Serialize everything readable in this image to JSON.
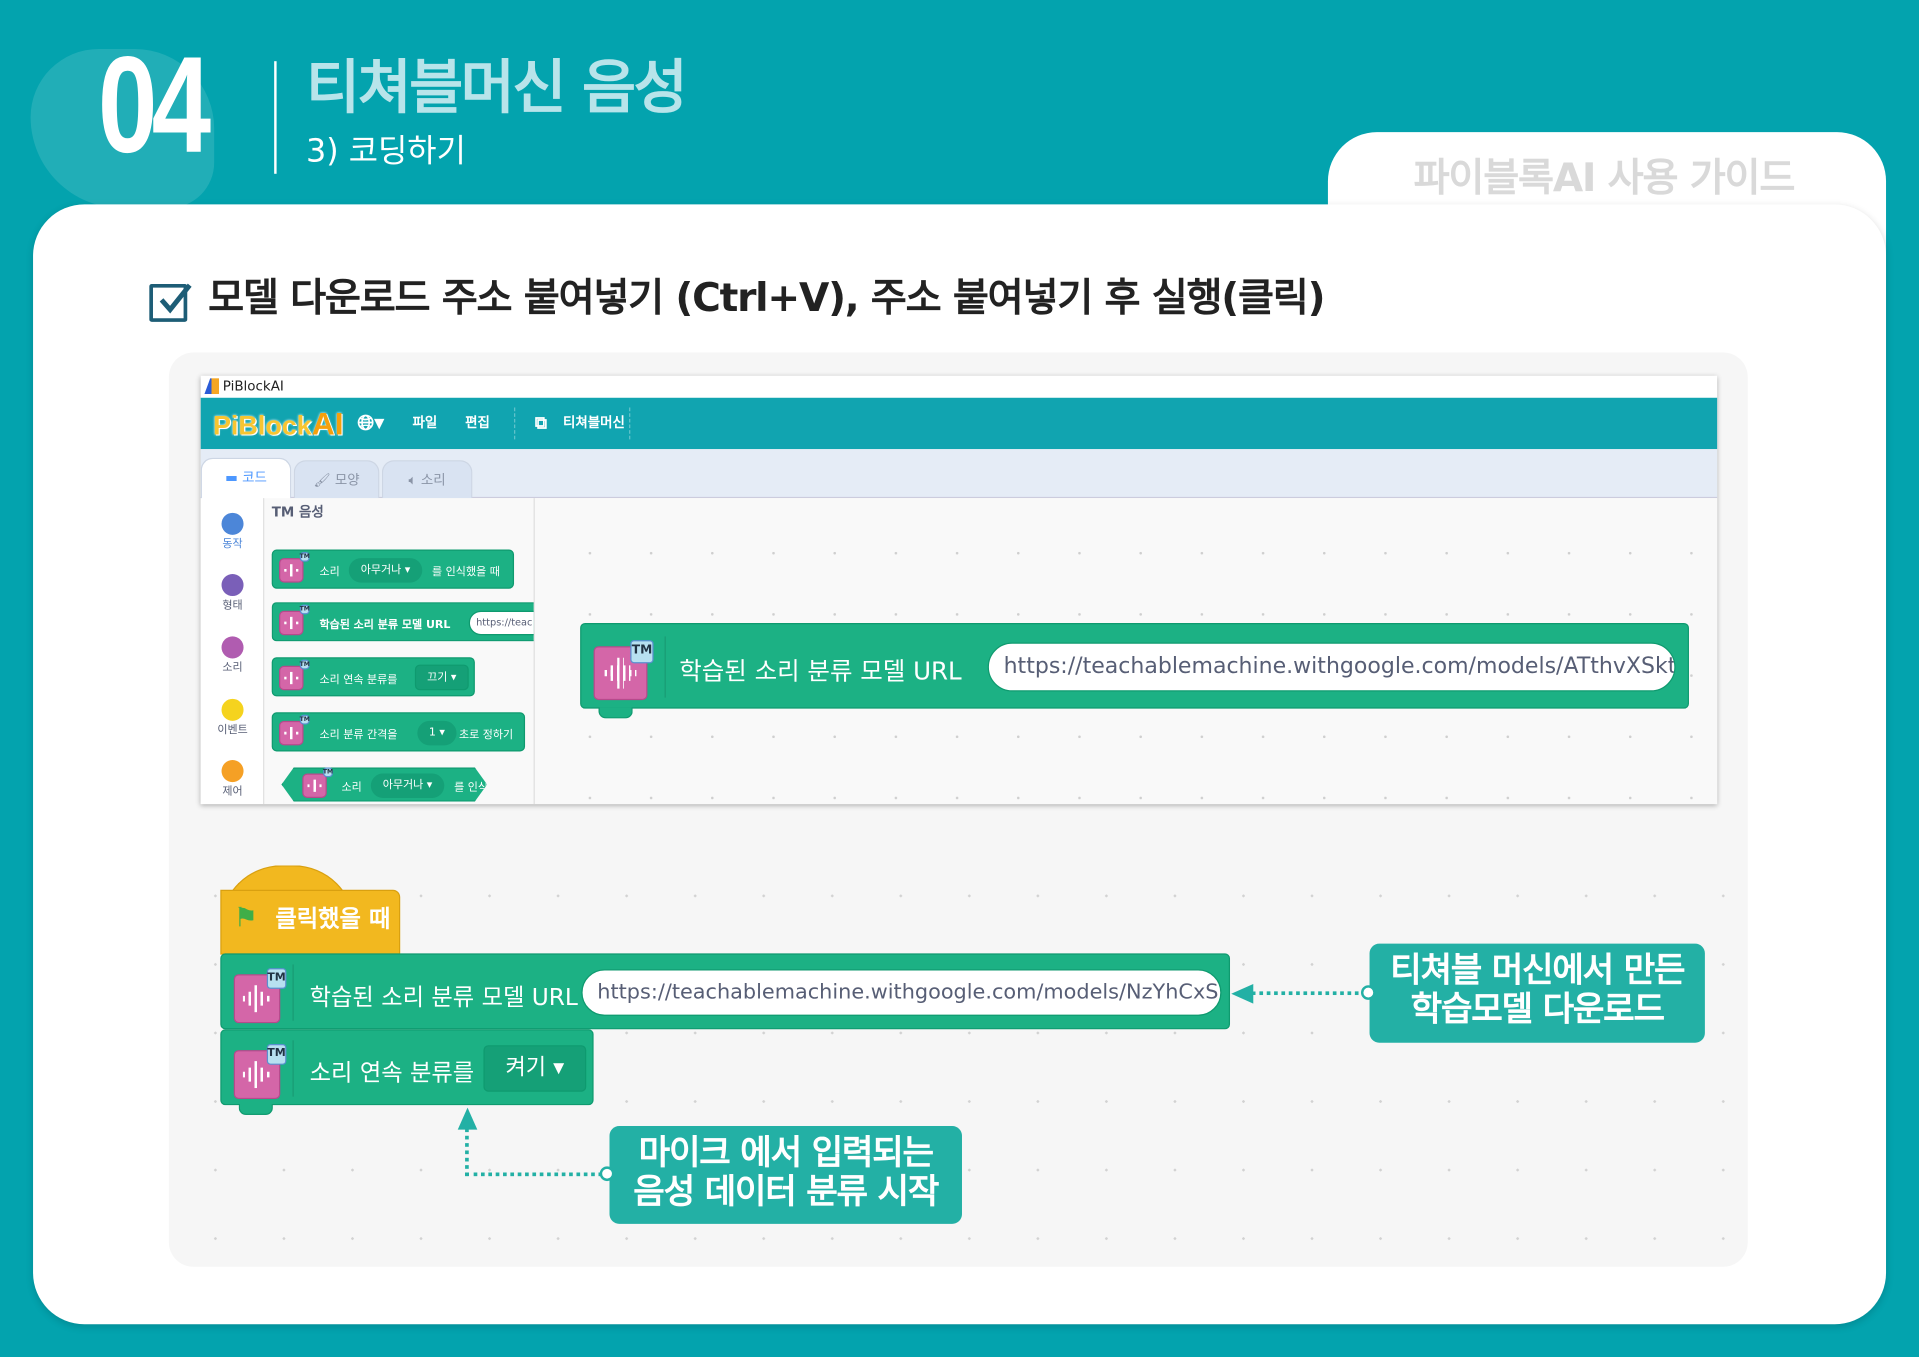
{
  "header": {
    "section_number": "04",
    "title": "티쳐블머신 음성",
    "subtitle": "3) 코딩하기",
    "guide_label": "파이블록AI 사용 가이드"
  },
  "instruction": {
    "text": "모델 다운로드 주소 붙여넣기 (Ctrl+V), 주소 붙여넣기 후 실행(클릭)"
  },
  "app": {
    "window_title": "PiBlockAI",
    "brand": {
      "left": "PiBlock",
      "right": "AI"
    },
    "menu": {
      "language_icon": "globe-icon",
      "file": "파일",
      "edit": "편집",
      "teachable": "티쳐블머신"
    },
    "tabs": [
      {
        "label": "코드",
        "active": true
      },
      {
        "label": "모양"
      },
      {
        "label": "소리"
      }
    ],
    "categories": [
      {
        "label": "동작",
        "color": "#4c86d8"
      },
      {
        "label": "형태",
        "color": "#7a5fb8"
      },
      {
        "label": "소리",
        "color": "#b05cb0"
      },
      {
        "label": "이벤트",
        "color": "#f5d31e"
      },
      {
        "label": "제어",
        "color": "#f5a025"
      }
    ],
    "palette": {
      "title": "TM 음성",
      "blocks": [
        {
          "pre": "소리",
          "dropdown": "아무거나",
          "post": "를 인식했을 때"
        },
        {
          "pre": "학습된 소리 분류 모델 URL",
          "input": "https://teac"
        },
        {
          "pre": "소리 연속 분류를",
          "dropdown": "끄기"
        },
        {
          "pre": "소리 분류 간격을",
          "dropdown": "1",
          "post": "초로 정하기"
        },
        {
          "pre": "소리",
          "dropdown": "아무거나",
          "post": "를 인식"
        }
      ]
    },
    "workspace_block": {
      "label": "학습된 소리 분류 모델 URL",
      "url": "https://teachablemachine.withgoogle.com/models/ATthvXSkt/"
    }
  },
  "script": {
    "hat_label": "클릭했을 때",
    "url_block": {
      "label": "학습된 소리 분류 모델 URL",
      "url": "https://teachablemachine.withgoogle.com/models/NzYhCxSKM/"
    },
    "continuous_block": {
      "label": "소리 연속 분류를",
      "dropdown": "켜기"
    }
  },
  "callouts": {
    "model": {
      "line1": "티쳐블 머신에서 만든",
      "line2": "학습모델 다운로드"
    },
    "mic": {
      "line1": "마이크 에서 입력되는",
      "line2": "음성 데이터 분류 시작"
    }
  },
  "tm_badge": "TM",
  "colors": {
    "background": "#03a3ae",
    "block": "#1cb184",
    "hat": "#f2b81f",
    "callout": "#23b0a5"
  }
}
